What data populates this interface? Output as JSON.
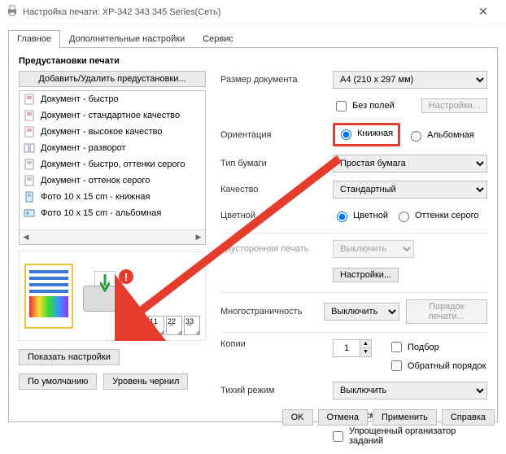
{
  "window": {
    "title": "Настройка печати: XP-342 343 345 Series(Сеть)"
  },
  "tabs": [
    "Главное",
    "Дополнительные настройки",
    "Сервис"
  ],
  "presets": {
    "heading": "Предустановки печати",
    "addRemove": "Добавить/Удалить предустановки...",
    "items": [
      "Документ - быстро",
      "Документ - стандартное качество",
      "Документ - высокое качество",
      "Документ - разворот",
      "Документ - быстро, оттенки серого",
      "Документ - оттенок серого",
      "Фото 10 x 15 cm - книжная",
      "Фото 10 x 15 cm - альбомная"
    ],
    "pageOrder": [
      "1̲1",
      "2̲2",
      "3̲3"
    ],
    "showSettings": "Показать настройки",
    "defaults": "По умолчанию",
    "inkLevels": "Уровень чернил"
  },
  "settings": {
    "docSize": {
      "label": "Размер документа",
      "value": "A4 (210 x 297 мм)"
    },
    "borderless": {
      "label": "Без полей",
      "settingsBtn": "Настройки..."
    },
    "orientation": {
      "label": "Ориентация",
      "portrait": "Книжная",
      "landscape": "Альбомная"
    },
    "paperType": {
      "label": "Тип бумаги",
      "value": "Простая бумага"
    },
    "quality": {
      "label": "Качество",
      "value": "Стандартный"
    },
    "color": {
      "label": "Цветной",
      "color": "Цветной",
      "gray": "Оттенки серого"
    },
    "duplex": {
      "label": "Двусторонняя печать",
      "value": "Выключить",
      "settingsBtn": "Настройки..."
    },
    "multipage": {
      "label": "Многостраничность",
      "value": "Выключить",
      "orderBtn": "Порядок печати..."
    },
    "copies": {
      "label": "Копии",
      "value": "1",
      "collate": "Подбор",
      "reverse": "Обратный порядок"
    },
    "quiet": {
      "label": "Тихий режим",
      "value": "Выключить"
    },
    "preview": "Просмотр",
    "simplified": "Упрощенный организатор заданий"
  },
  "dialog": {
    "ok": "OK",
    "cancel": "Отмена",
    "apply": "Применить",
    "help": "Справка"
  }
}
